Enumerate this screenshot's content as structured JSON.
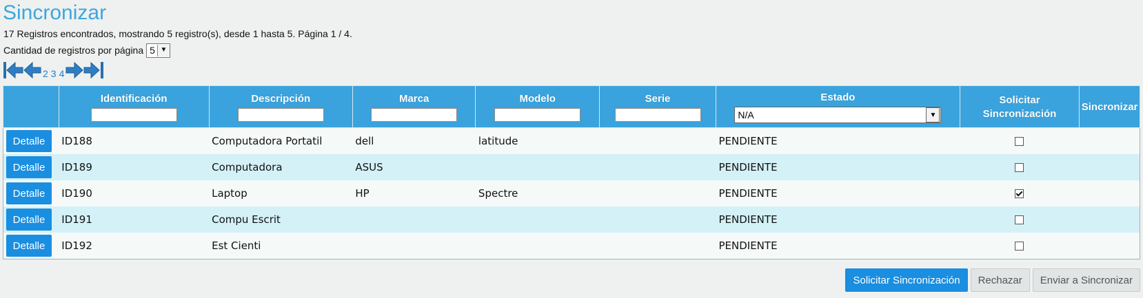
{
  "page": {
    "title": "Sincronizar",
    "summary": "17 Registros encontrados, mostrando 5 registro(s), desde 1 hasta 5. Página 1 / 4.",
    "per_page_label": "Cantidad de registros por página",
    "per_page_value": "5"
  },
  "pager": {
    "pages": [
      "2",
      "3",
      "4"
    ],
    "icons": [
      "first-page-icon",
      "prev-page-icon",
      "next-page-icon",
      "last-page-icon"
    ]
  },
  "table": {
    "headers": {
      "identificacion": "Identificación",
      "descripcion": "Descripción",
      "marca": "Marca",
      "modelo": "Modelo",
      "serie": "Serie",
      "estado": "Estado",
      "solicitar_line1": "Solicitar",
      "solicitar_line2": "Sincronización",
      "sincronizar": "Sincronizar"
    },
    "estado_filter": "N/A",
    "detail_label": "Detalle",
    "rows": [
      {
        "id": "ID188",
        "descripcion": "Computadora Portatil",
        "marca": "dell",
        "modelo": "latitude",
        "serie": "",
        "estado": "PENDIENTE",
        "solicitar": false
      },
      {
        "id": "ID189",
        "descripcion": "Computadora",
        "marca": "ASUS",
        "modelo": "",
        "serie": "",
        "estado": "PENDIENTE",
        "solicitar": false
      },
      {
        "id": "ID190",
        "descripcion": "Laptop",
        "marca": "HP",
        "modelo": "Spectre",
        "serie": "",
        "estado": "PENDIENTE",
        "solicitar": true
      },
      {
        "id": "ID191",
        "descripcion": "Compu Escrit",
        "marca": "",
        "modelo": "",
        "serie": "",
        "estado": "PENDIENTE",
        "solicitar": false
      },
      {
        "id": "ID192",
        "descripcion": "Est Cienti",
        "marca": "",
        "modelo": "",
        "serie": "",
        "estado": "PENDIENTE",
        "solicitar": false
      }
    ]
  },
  "actions": {
    "solicitar": "Solicitar Sincronización",
    "rechazar": "Rechazar",
    "enviar": "Enviar a Sincronizar"
  },
  "colors": {
    "accent": "#3aa3dd",
    "button": "#1a8ee0",
    "row_alt": "#d3f1f7"
  }
}
